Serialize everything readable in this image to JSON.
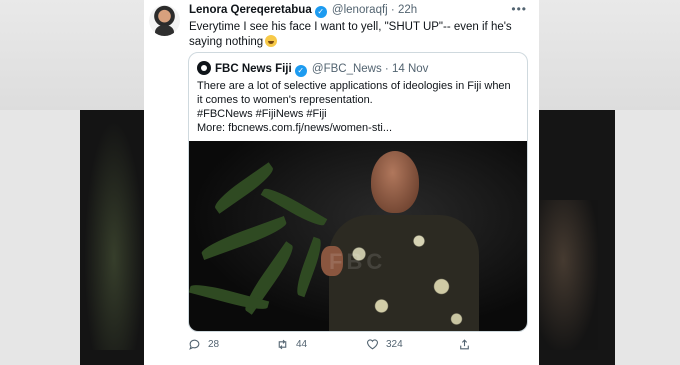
{
  "tweet": {
    "author_name": "Lenora Qereqeretabua",
    "author_handle": "@lenoraqfj",
    "separator": "·",
    "time": "22h",
    "text": "Everytime I see his face I want to yell, \"SHUT UP\"-- even if he's saying nothing",
    "more_icon": "more-icon"
  },
  "quote": {
    "author_name": "FBC News Fiji",
    "author_handle": "@FBC_News",
    "separator": "·",
    "date": "14 Nov",
    "text_line1": "There are a lot of selective applications of ideologies in Fiji when it comes to women's representation.",
    "hashtags": "#FBCNews  #FijiNews #Fiji",
    "more_link": "More: fbcnews.com.fj/news/women-sti...",
    "media_watermark": "FBC"
  },
  "actions": {
    "reply_count": "28",
    "retweet_count": "44",
    "like_count": "324"
  },
  "colors": {
    "accent": "#1d9bf0",
    "text": "#0f1419",
    "muted": "#536471",
    "border": "#cfd9de"
  }
}
